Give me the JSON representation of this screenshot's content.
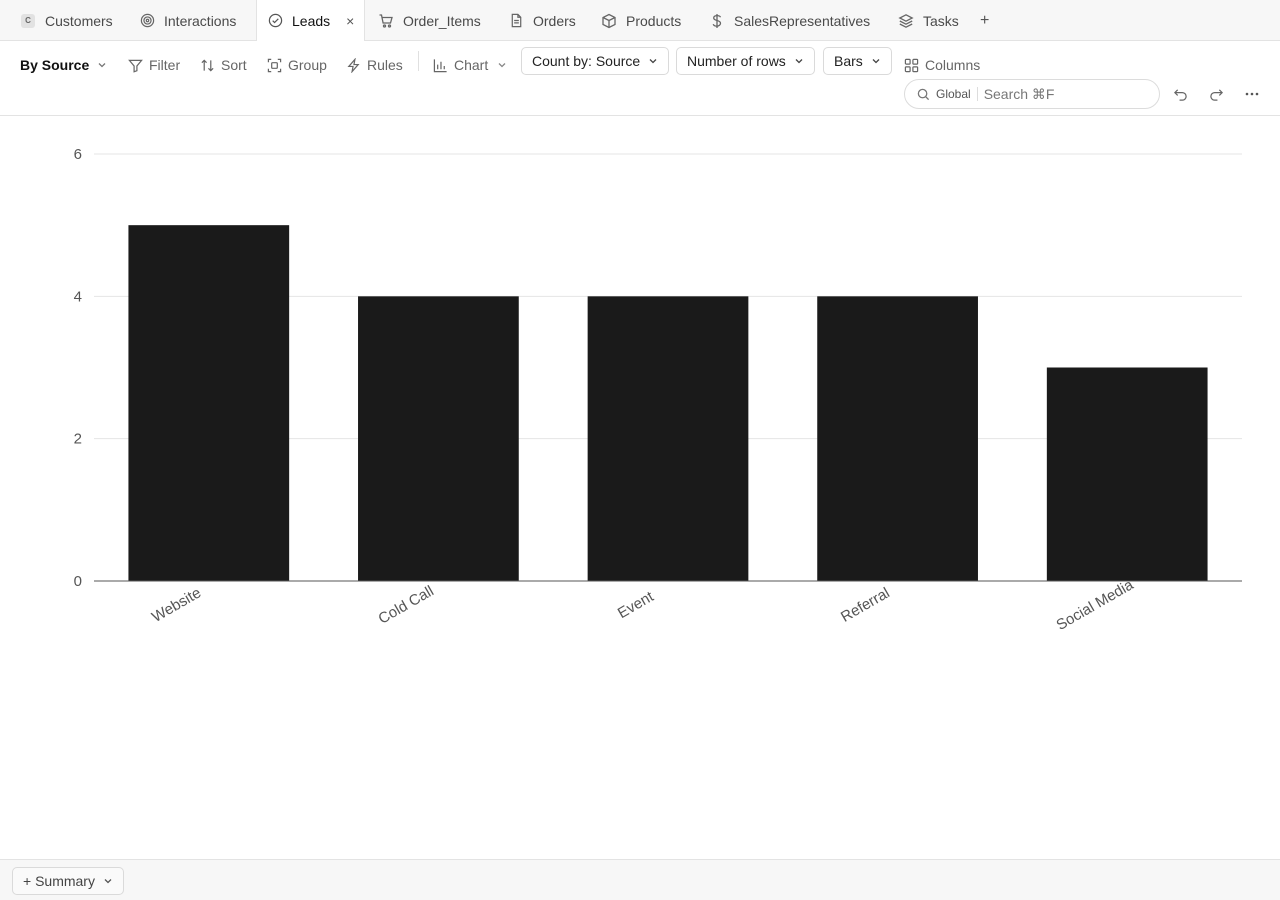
{
  "tabs": [
    {
      "label": "Customers",
      "icon": "c-badge-icon"
    },
    {
      "label": "Interactions",
      "icon": "target-icon"
    },
    {
      "label": "Leads",
      "icon": "check-circle-icon",
      "active": true,
      "close": "×"
    },
    {
      "label": "Order_Items",
      "icon": "cart-icon"
    },
    {
      "label": "Orders",
      "icon": "document-icon"
    },
    {
      "label": "Products",
      "icon": "box-icon"
    },
    {
      "label": "SalesRepresentatives",
      "icon": "dollar-icon"
    },
    {
      "label": "Tasks",
      "icon": "layers-icon"
    }
  ],
  "tab_customers_badge": "C",
  "add_tab": "+",
  "toolbar": {
    "view": "By Source",
    "filter": "Filter",
    "sort": "Sort",
    "group": "Group",
    "rules": "Rules",
    "chart": "Chart",
    "count_by": "Count by: Source",
    "metric": "Number of rows",
    "chart_style": "Bars",
    "columns": "Columns"
  },
  "search": {
    "scope": "Global",
    "placeholder": "Search ⌘F"
  },
  "chart_data": {
    "type": "bar",
    "categories": [
      "Website",
      "Cold Call",
      "Event",
      "Referral",
      "Social Media"
    ],
    "values": [
      5,
      4,
      4,
      4,
      3
    ],
    "ylim": [
      0,
      6
    ],
    "yticks": [
      0,
      2,
      4,
      6
    ],
    "bar_color": "#1a1a1a",
    "grid": true
  },
  "footer": {
    "summary": "+ Summary"
  }
}
